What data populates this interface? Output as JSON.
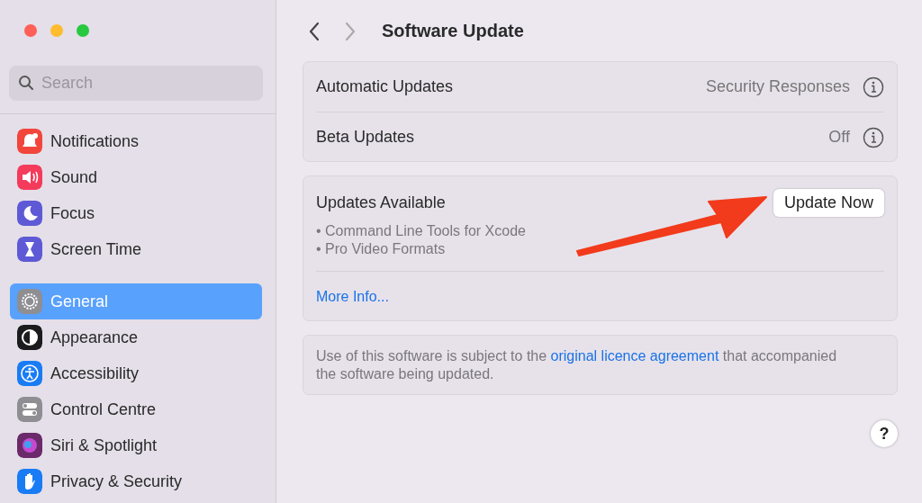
{
  "sidebar": {
    "search": {
      "placeholder": "Search"
    },
    "groups": [
      [
        {
          "label": "Notifications",
          "color": "#f2463c",
          "selected": false
        },
        {
          "label": "Sound",
          "color": "#f43b5c",
          "selected": false
        },
        {
          "label": "Focus",
          "color": "#5e5ad6",
          "selected": false
        },
        {
          "label": "Screen Time",
          "color": "#5e5ad6",
          "selected": false
        }
      ],
      [
        {
          "label": "General",
          "color": "#8e8e93",
          "selected": true
        },
        {
          "label": "Appearance",
          "color": "#1c1c1e",
          "selected": false
        },
        {
          "label": "Accessibility",
          "color": "#1a7cf5",
          "selected": false
        },
        {
          "label": "Control Centre",
          "color": "#8e8e93",
          "selected": false
        },
        {
          "label": "Siri & Spotlight",
          "color": "#6b2a6a",
          "selected": false
        },
        {
          "label": "Privacy & Security",
          "color": "#1a7cf5",
          "selected": false
        }
      ]
    ]
  },
  "header": {
    "title": "Software Update"
  },
  "settings": [
    {
      "label": "Automatic Updates",
      "value": "Security Responses"
    },
    {
      "label": "Beta Updates",
      "value": "Off"
    }
  ],
  "updates": {
    "title": "Updates Available",
    "button": "Update Now",
    "items": [
      "• Command Line Tools for Xcode",
      "• Pro Video Formats"
    ],
    "link": "More Info..."
  },
  "licence": {
    "text_before": "Use of this software is subject to the ",
    "link": "original licence agreement",
    "text_after": " that accompanied the software being updated."
  },
  "help_button": "?"
}
